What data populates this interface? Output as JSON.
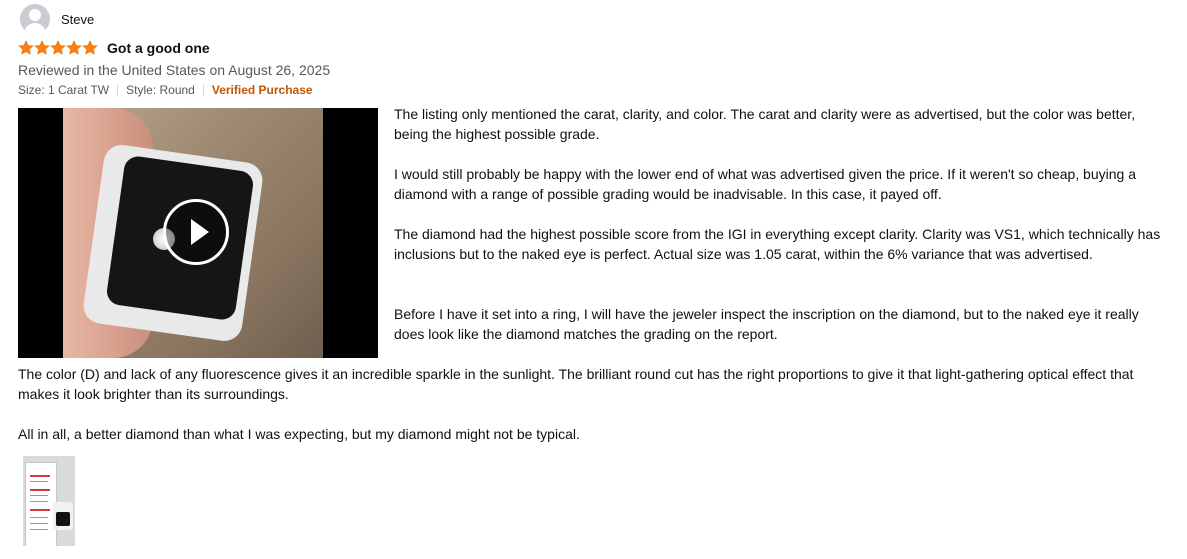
{
  "profile": {
    "name": "Steve"
  },
  "review": {
    "rating": 5,
    "rating_max": 5,
    "title": "Got a good one",
    "date_line": "Reviewed in the United States on August 26, 2025",
    "format": {
      "size": "Size: 1 Carat TW",
      "style": "Style: Round",
      "verified": "Verified Purchase"
    },
    "paragraphs": [
      "The listing only mentioned the carat, clarity, and color. The carat and clarity were as advertised, but the color was better, being the highest possible grade.",
      "I would still probably be happy with the lower end of what was advertised given the price. If it weren't so cheap, buying a diamond with a range of possible grading would be inadvisable. In this case, it payed off.",
      "The diamond had the highest possible score from the IGI in everything except clarity. Clarity was VS1, which technically has inclusions but to the naked eye is perfect. Actual size was 1.05 carat, within the 6% variance that was advertised.",
      "Before I have it set into a ring, I will have the jeweler inspect the inscription on the diamond, but to the naked eye it really does look like the diamond matches the grading on the report.",
      "The color (D) and lack of any fluorescence gives it an incredible sparkle in the sunlight. The brilliant round cut has the right proportions to give it that light-gathering optical effect that makes it look brighter than its surroundings.",
      "All in all, a better diamond than what I was expecting, but my diamond might not be typical."
    ]
  },
  "colors": {
    "star": "#ff7c11",
    "verified": "#c45500",
    "secondary_text": "#565959"
  },
  "icons": {
    "avatar": "user-avatar-icon",
    "star": "star-icon",
    "play": "play-icon"
  }
}
